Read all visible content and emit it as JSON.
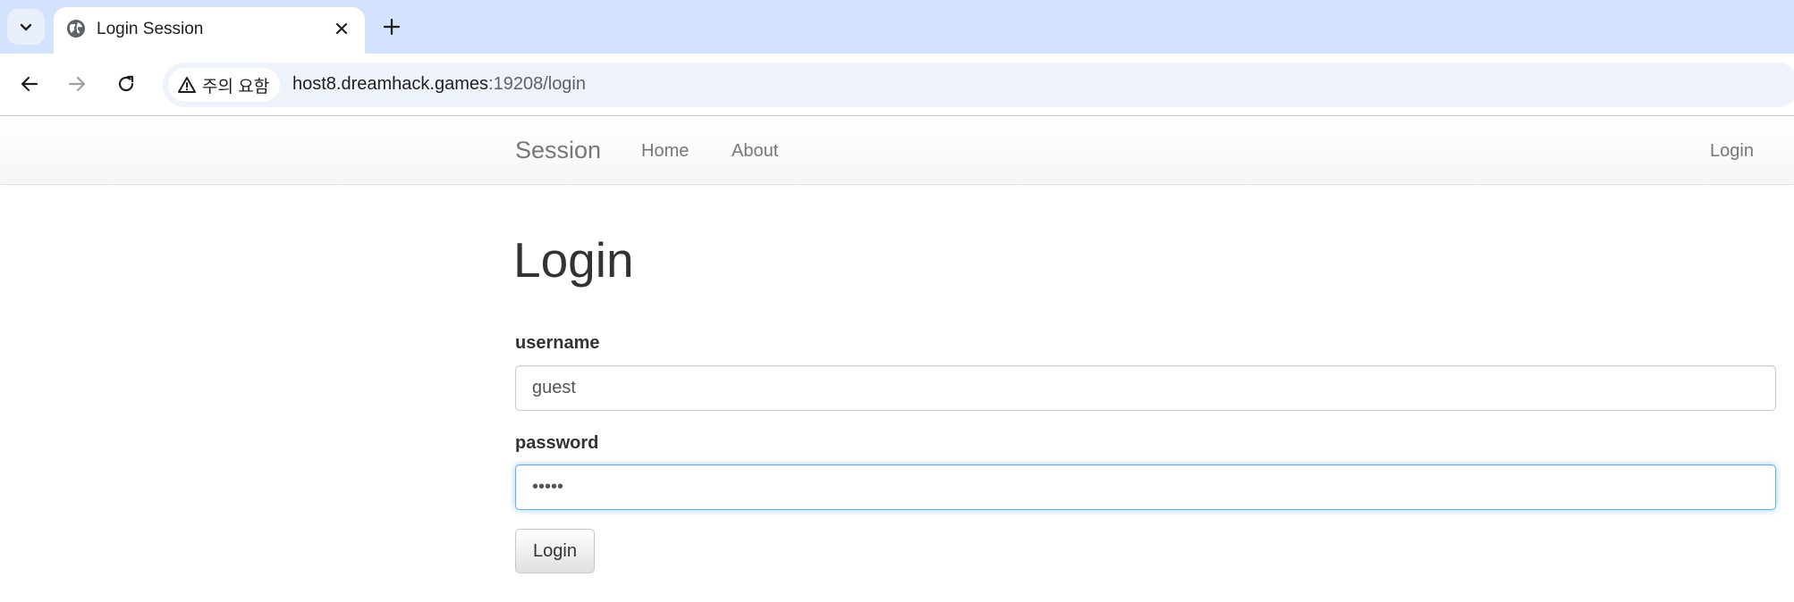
{
  "browser": {
    "tab": {
      "title": "Login Session"
    },
    "address_bar": {
      "security_label": "주의 요함",
      "url_host": "host8.dreamhack.games",
      "url_path": ":19208/login"
    },
    "icons": {
      "tab_search": "chevron-down-icon",
      "favicon": "globe-icon",
      "close_tab": "close-icon",
      "new_tab": "plus-icon",
      "back": "arrow-left-icon",
      "forward": "arrow-right-icon",
      "reload": "reload-icon",
      "security": "warning-triangle-icon"
    },
    "colors": {
      "tabstrip_bg": "#d3e3fd",
      "omnibox_bg": "#eef2fa"
    }
  },
  "navbar": {
    "brand": "Session",
    "links": [
      "Home",
      "About"
    ],
    "right_link": "Login"
  },
  "form": {
    "heading": "Login",
    "username": {
      "label": "username",
      "value": "guest"
    },
    "password": {
      "label": "password",
      "value": "guest",
      "focused": true
    },
    "submit_label": "Login",
    "colors": {
      "focus_border": "#66afe9",
      "text": "#333333",
      "nav_text": "#777777"
    }
  }
}
